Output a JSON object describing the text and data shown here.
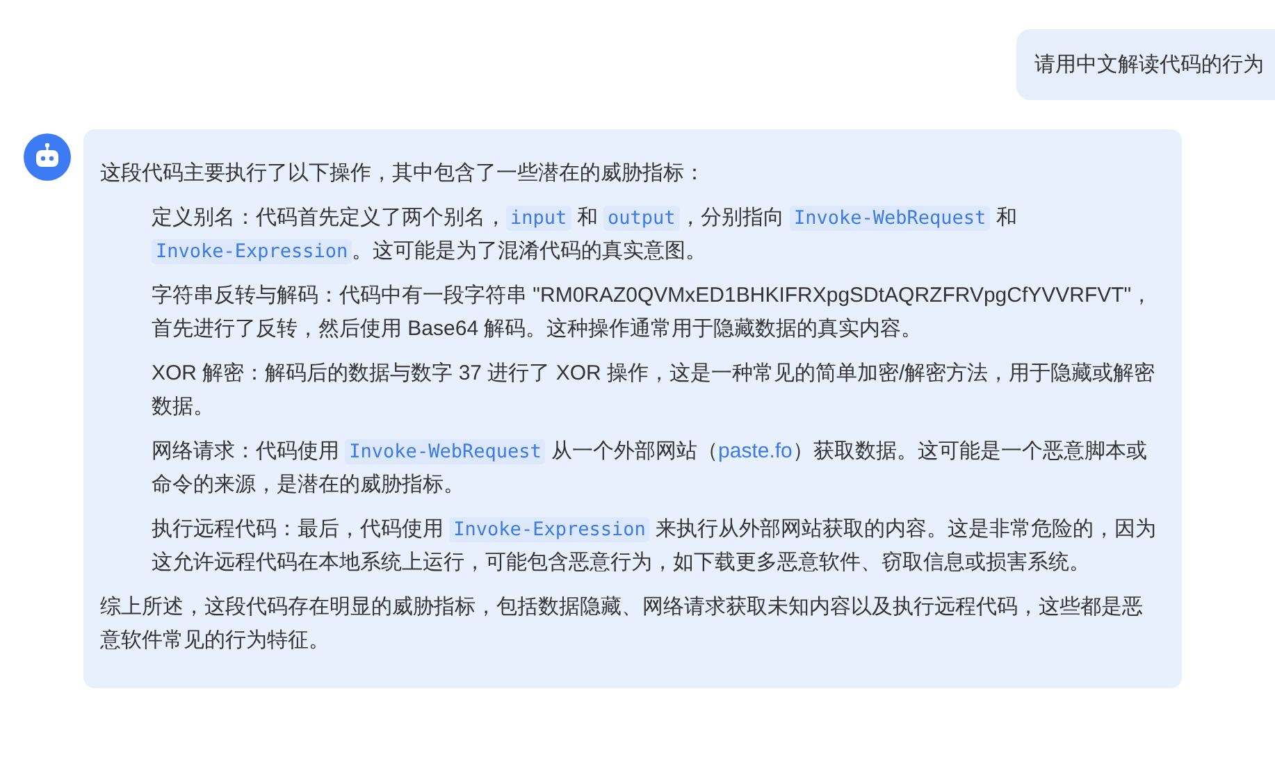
{
  "user_message": {
    "text": "请用中文解读代码的行为"
  },
  "bot_message": {
    "intro": "这段代码主要执行了以下操作，其中包含了一些潜在的威胁指标：",
    "items": [
      [
        {
          "kind": "text",
          "text": "定义别名：代码首先定义了两个别名，"
        },
        {
          "kind": "code",
          "text": "input"
        },
        {
          "kind": "text",
          "text": " 和 "
        },
        {
          "kind": "code",
          "text": "output"
        },
        {
          "kind": "text",
          "text": "，分别指向 "
        },
        {
          "kind": "code",
          "text": "Invoke-WebRequest"
        },
        {
          "kind": "text",
          "text": " 和 "
        },
        {
          "kind": "code",
          "text": "Invoke-Expression"
        },
        {
          "kind": "text",
          "text": "。这可能是为了混淆代码的真实意图。"
        }
      ],
      [
        {
          "kind": "text",
          "text": "字符串反转与解码：代码中有一段字符串 \"RM0RAZ0QVMxED1BHKIFRXpgSDtAQRZFRVpgCfYVVRFVT\"，首先进行了反转，然后使用 Base64 解码。这种操作通常用于隐藏数据的真实内容。"
        }
      ],
      [
        {
          "kind": "text",
          "text": "XOR 解密：解码后的数据与数字 37 进行了 XOR 操作，这是一种常见的简单加密/解密方法，用于隐藏或解密数据。"
        }
      ],
      [
        {
          "kind": "text",
          "text": "网络请求：代码使用 "
        },
        {
          "kind": "code",
          "text": "Invoke-WebRequest"
        },
        {
          "kind": "text",
          "text": " 从一个外部网站（"
        },
        {
          "kind": "link",
          "text": "paste.fo"
        },
        {
          "kind": "text",
          "text": "）获取数据。这可能是一个恶意脚本或命令的来源，是潜在的威胁指标。"
        }
      ],
      [
        {
          "kind": "text",
          "text": "执行远程代码：最后，代码使用 "
        },
        {
          "kind": "code",
          "text": "Invoke-Expression"
        },
        {
          "kind": "text",
          "text": " 来执行从外部网站获取的内容。这是非常危险的，因为这允许远程代码在本地系统上运行，可能包含恶意行为，如下载更多恶意软件、窃取信息或损害系统。"
        }
      ]
    ],
    "summary": "综上所述，这段代码存在明显的威胁指标，包括数据隐藏、网络请求获取未知内容以及执行远程代码，这些都是恶意软件常见的行为特征。"
  }
}
